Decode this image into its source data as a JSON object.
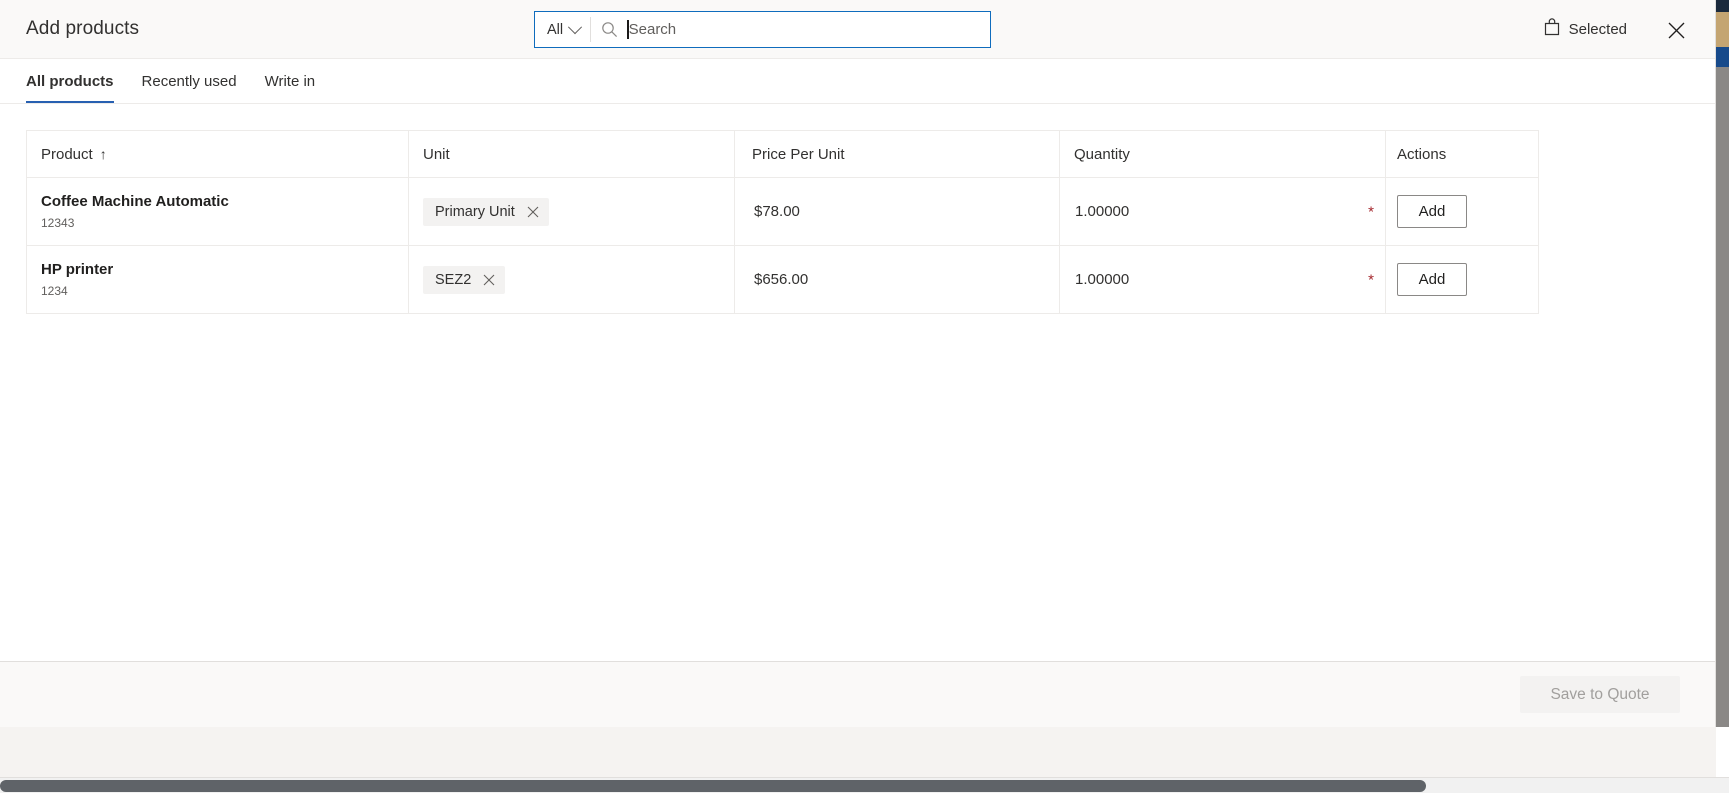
{
  "dialog": {
    "title": "Add products",
    "close_icon": "close-icon"
  },
  "search": {
    "scope_label": "All",
    "scope_chevron_icon": "chevron-down-icon",
    "search_icon": "search-icon",
    "placeholder": "Search",
    "value": ""
  },
  "header_actions": {
    "selected_label": "Selected",
    "selected_icon": "shopping-bag-icon"
  },
  "tabs": [
    {
      "label": "All products",
      "active": true
    },
    {
      "label": "Recently used",
      "active": false
    },
    {
      "label": "Write in",
      "active": false
    }
  ],
  "table": {
    "columns": [
      {
        "label": "Product",
        "sort": "ascending",
        "sort_glyph": "↑"
      },
      {
        "label": "Unit"
      },
      {
        "label": "Price Per Unit"
      },
      {
        "label": "Quantity"
      },
      {
        "label": "Actions"
      }
    ],
    "rows": [
      {
        "product_name": "Coffee Machine Automatic",
        "product_id": "12343",
        "unit_chip": "Primary Unit",
        "unit_chip_remove_icon": "close-icon",
        "price_per_unit": "$78.00",
        "quantity": "1.00000",
        "quantity_required_marker": "*",
        "action_label": "Add"
      },
      {
        "product_name": "HP printer",
        "product_id": "1234",
        "unit_chip": "SEZ2",
        "unit_chip_remove_icon": "close-icon",
        "price_per_unit": "$656.00",
        "quantity": "1.00000",
        "quantity_required_marker": "*",
        "action_label": "Add"
      }
    ]
  },
  "footer": {
    "save_label": "Save to Quote",
    "save_disabled": true
  },
  "colors": {
    "accent_blue": "#2760b1",
    "focus_border": "#0f6cbd",
    "required_red": "#a4262c",
    "header_bg": "#faf9f8",
    "border": "#edebe9"
  }
}
